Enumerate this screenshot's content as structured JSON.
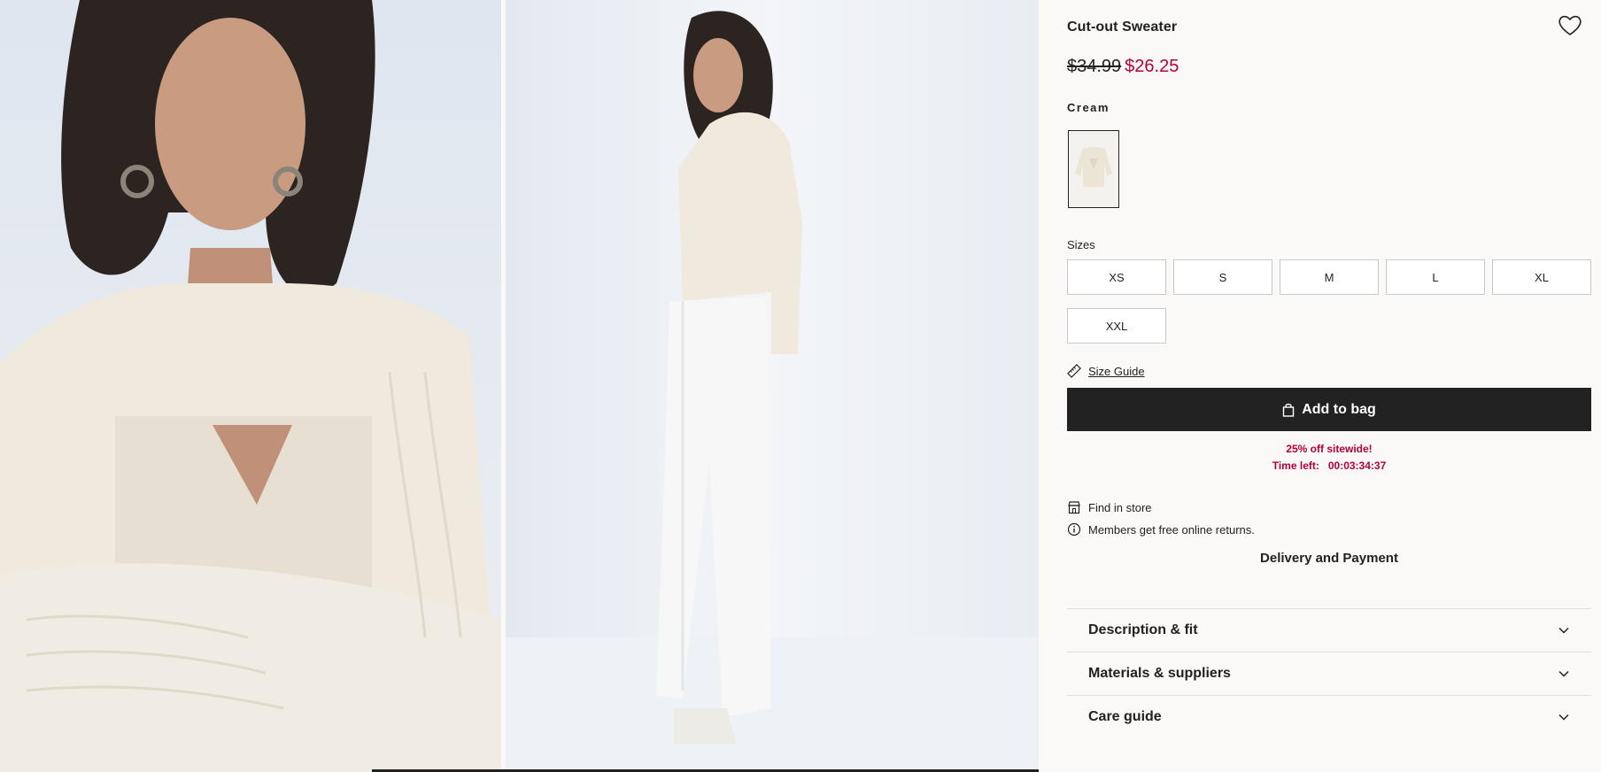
{
  "product": {
    "title": "Cut-out Sweater",
    "old_price": "$34.99",
    "new_price": "$26.25",
    "color_name": "Cream"
  },
  "sizes": {
    "label": "Sizes",
    "options": [
      "XS",
      "S",
      "M",
      "L",
      "XL",
      "XXL"
    ]
  },
  "size_guide": "Size Guide",
  "add_to_bag": "Add to bag",
  "promo": {
    "headline": "25% off sitewide!",
    "time_label": "Time left:",
    "time_value": "00:03:34:37"
  },
  "info": {
    "find_in_store": "Find in store",
    "returns": "Members get free online returns.",
    "delivery": "Delivery and Payment"
  },
  "accordions": [
    "Description & fit",
    "Materials & suppliers",
    "Care guide"
  ],
  "colors": {
    "sale": "#b4003c",
    "button": "#222222",
    "background": "#faf9f8"
  }
}
